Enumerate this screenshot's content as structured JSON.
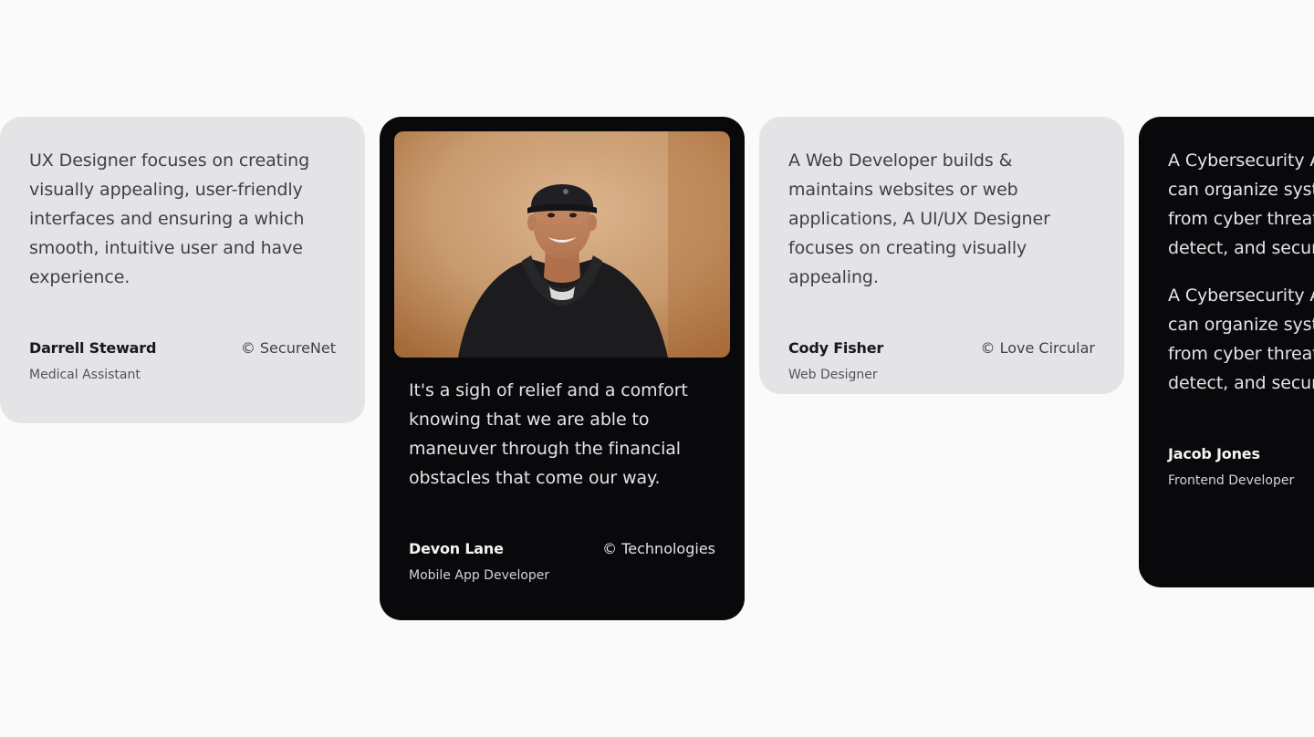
{
  "testimonials": [
    {
      "quote": "UX Designer focuses on creating visually appealing, user-friendly interfaces and ensuring a which smooth, intuitive user and have experience.",
      "name": "Darrell Steward",
      "company": "© SecureNet",
      "role": "Medical Assistant",
      "theme": "light"
    },
    {
      "quote": "It's a sigh of relief and a comfort knowing that we are able to maneuver through the financial obstacles that come our way.",
      "name": "Devon Lane",
      "company": "© Technologies",
      "role": "Mobile App Developer",
      "theme": "dark"
    },
    {
      "quote": "A Web Developer builds & maintains websites or web applications, A UI/UX Designer focuses on creating visually appealing.",
      "name": "Cody Fisher",
      "company": "© Love Circular",
      "role": "Web Designer",
      "theme": "light"
    },
    {
      "quote": "A Cybersecurity Analyst is which can organize systems and data from cyber threats, monitor, detect, and security breaches.",
      "quote2": "A Cybersecurity Analyst is which can organize systems and data from cyber threats, monitor, detect, and security breaches.",
      "name": "Jacob Jones",
      "company": "",
      "role": "Frontend Developer",
      "theme": "dark"
    }
  ],
  "colors": {
    "page_bg": "#fafafa",
    "light_card": "#e4e4e7",
    "dark_card": "#09090b"
  }
}
